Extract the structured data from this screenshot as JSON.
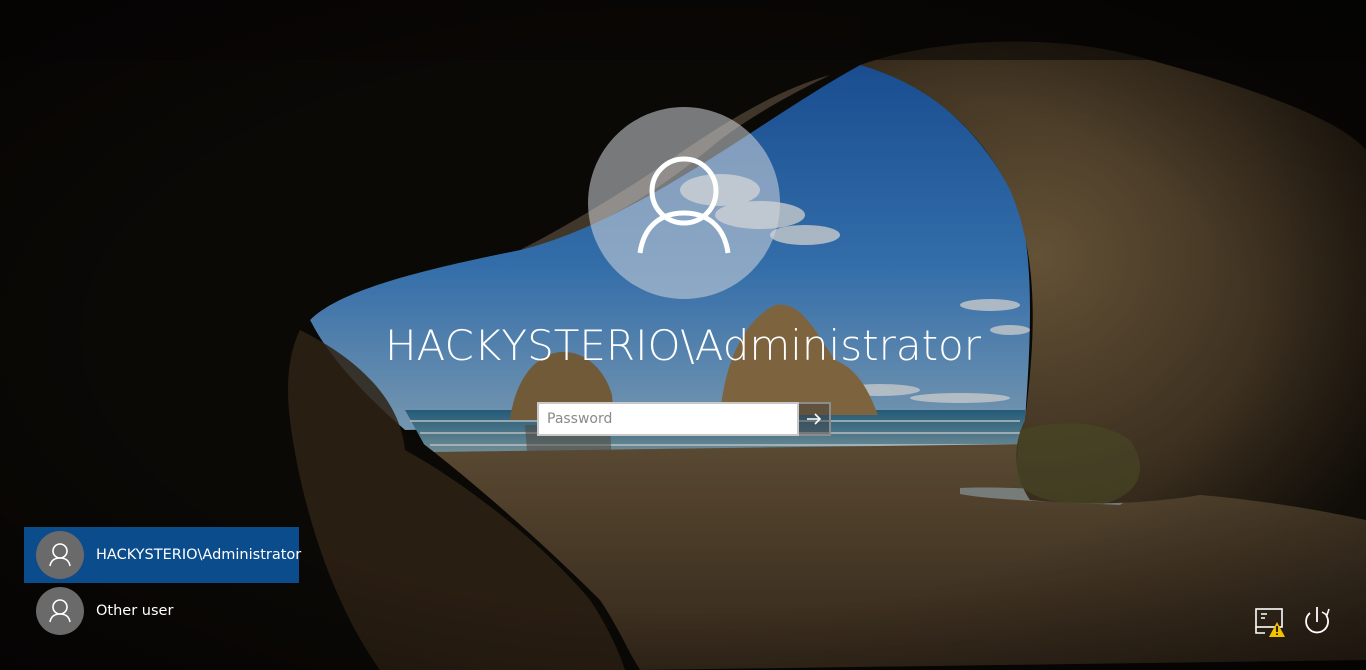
{
  "lock_screen": {
    "user_title": "HACKYSTERIO\\Administrator",
    "password_placeholder": "Password",
    "password_value": ""
  },
  "user_list": [
    {
      "label": "HACKYSTERIO\\Administrator",
      "selected": true
    },
    {
      "label": "Other user",
      "selected": false
    }
  ],
  "corner_icons": {
    "network": "network-warning-icon",
    "power": "power-icon"
  },
  "colors": {
    "selected_tile": "#0b4c8c",
    "tile_avatar": "#6a6a6a",
    "warning": "#f2c200"
  }
}
